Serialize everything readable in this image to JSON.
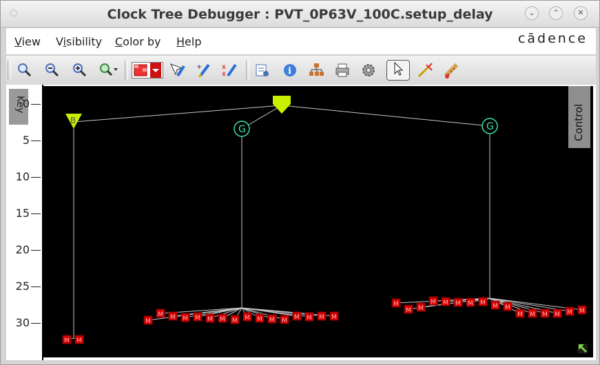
{
  "window": {
    "title": "Clock Tree Debugger : PVT_0P63V_100C.setup_delay",
    "buttons": [
      "minimize",
      "maximize",
      "close"
    ]
  },
  "menu": {
    "items": [
      {
        "label": "View",
        "accel": "V"
      },
      {
        "label": "Visibility",
        "accel": "i"
      },
      {
        "label": "Color by",
        "accel": "C"
      },
      {
        "label": "Help",
        "accel": "H"
      }
    ],
    "logo": "cādence"
  },
  "toolbar": {
    "icons": [
      "zoom-fit-icon",
      "zoom-out-icon",
      "zoom-in-icon",
      "zoom-select-icon",
      "color-pattern-icon",
      "select-edit-icon",
      "add-edit-icon",
      "remove-edit-icon",
      "report-icon",
      "info-icon",
      "hierarchy-icon",
      "print-icon",
      "settings-icon",
      "pointer-icon",
      "flare-icon",
      "ruler-icon"
    ]
  },
  "axis": {
    "ticks": [
      "0",
      "5",
      "10",
      "15",
      "20",
      "25",
      "30"
    ],
    "key_label": "Key",
    "control_label": "Control"
  },
  "tree": {
    "root_label": "",
    "buffer_label": "B",
    "gate_label": "G",
    "sink_label": "M",
    "colors": {
      "root": "#c8f000",
      "gate": "#3ee3b0",
      "sink": "#d40000",
      "wire": "#c8c8c8"
    }
  }
}
